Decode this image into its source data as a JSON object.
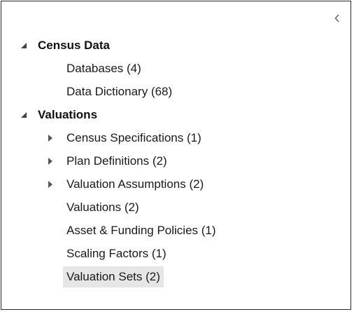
{
  "tree": {
    "groups": [
      {
        "label": "Census Data",
        "expanded": true,
        "children": [
          {
            "label": "Databases (4)"
          },
          {
            "label": "Data Dictionary (68)"
          }
        ]
      },
      {
        "label": "Valuations",
        "expanded": true,
        "children": [
          {
            "label": "Census Specifications (1)",
            "expandable": true
          },
          {
            "label": "Plan Definitions (2)",
            "expandable": true
          },
          {
            "label": "Valuation Assumptions (2)",
            "expandable": true
          },
          {
            "label": "Valuations (2)"
          },
          {
            "label": "Asset & Funding Policies (1)"
          },
          {
            "label": "Scaling Factors (1)"
          },
          {
            "label": "Valuation Sets (2)",
            "selected": true
          }
        ]
      }
    ]
  },
  "icons": {
    "collapse": "chevron-left-icon",
    "expanded": "triangle-expanded-icon",
    "collapsed": "triangle-collapsed-icon"
  }
}
